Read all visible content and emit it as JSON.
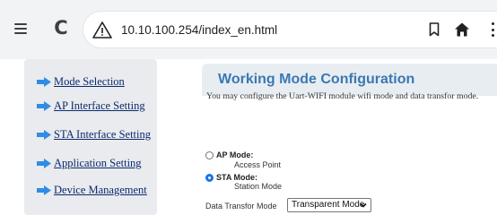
{
  "browser": {
    "url": "10.10.100.254/index_en.html"
  },
  "sidebar": {
    "items": [
      {
        "label": "Mode Selection"
      },
      {
        "label": "AP Interface Setting"
      },
      {
        "label": "STA Interface Setting"
      },
      {
        "label": "Application Setting"
      },
      {
        "label": "Device Management"
      }
    ]
  },
  "main": {
    "title": "Working Mode Configuration",
    "description": "You may configure the Uart-WIFI module wifi mode and data transfor mode.",
    "modes": [
      {
        "label": "AP Mode:",
        "sublabel": "Access Point",
        "selected": false
      },
      {
        "label": "STA Mode:",
        "sublabel": "Station Mode",
        "selected": true
      }
    ],
    "data_transfer": {
      "label": "Data Transfor Mode",
      "selected": "Transparent Mode"
    }
  },
  "colors": {
    "title": "#3b78b3",
    "nav_link": "#0c2b6e",
    "nav_arrow": "#2f8de4",
    "radio_checked": "#1a73e8"
  },
  "icons": [
    "menu-icon",
    "reload-icon",
    "warning-icon",
    "bookmark-icon",
    "home-icon",
    "more-vert-icon",
    "right-arrow-icon",
    "chevron-down-icon"
  ]
}
